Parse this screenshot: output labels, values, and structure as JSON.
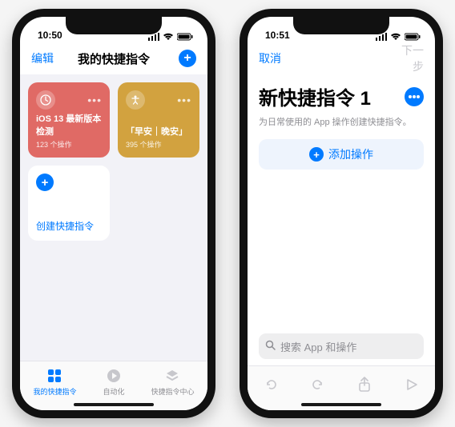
{
  "left": {
    "status": {
      "time": "10:50"
    },
    "nav": {
      "edit": "编辑",
      "title": "我的快捷指令"
    },
    "cards": [
      {
        "title": "iOS 13 最新版本检测",
        "sub": "123 个操作"
      },
      {
        "title": "「早安｜晚安」",
        "sub": "395 个操作"
      }
    ],
    "create": {
      "label": "创建快捷指令"
    },
    "tabs": {
      "shortcuts": "我的快捷指令",
      "automation": "自动化",
      "gallery": "快捷指令中心"
    }
  },
  "right": {
    "status": {
      "time": "10:51"
    },
    "nav": {
      "cancel": "取消",
      "next": "下一步"
    },
    "title": "新快捷指令 1",
    "subtitle": "为日常使用的 App 操作创建快捷指令。",
    "addAction": "添加操作",
    "search": {
      "placeholder": "搜索 App 和操作"
    }
  }
}
